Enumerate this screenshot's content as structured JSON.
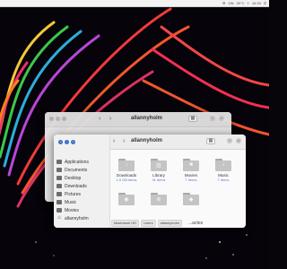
{
  "menubar": {
    "items": [
      "⚙",
      "ON",
      "20°C",
      "≡",
      "10:33",
      "⏻"
    ]
  },
  "back_window": {
    "title": "allannyholm"
  },
  "front_window": {
    "title": "allannyholm",
    "sidebar": {
      "items": [
        {
          "label": "Applications",
          "icon": "applications-icon"
        },
        {
          "label": "Documents",
          "icon": "documents-icon"
        },
        {
          "label": "Desktop",
          "icon": "desktop-icon"
        },
        {
          "label": "Downloads",
          "icon": "downloads-icon"
        },
        {
          "label": "Pictures",
          "icon": "pictures-icon"
        },
        {
          "label": "Music",
          "icon": "music-icon"
        },
        {
          "label": "Movies",
          "icon": "movies-icon"
        },
        {
          "label": "allannyholm",
          "icon": "home-icon"
        }
      ]
    },
    "files": [
      {
        "name": "Downloads",
        "size": "1.5 GB items",
        "glyph": "↓"
      },
      {
        "name": "Library",
        "size": "31 items",
        "glyph": "▥"
      },
      {
        "name": "Movies",
        "size": "7 items",
        "glyph": "■"
      },
      {
        "name": "Music",
        "size": "7 items",
        "glyph": "♪"
      },
      {
        "name": "",
        "size": "",
        "glyph": "◉"
      },
      {
        "name": "",
        "size": "",
        "glyph": "⊕"
      },
      {
        "name": "",
        "size": "",
        "glyph": "◆"
      }
    ],
    "pathbar": [
      "Macintosh HD",
      "Users",
      "allannyholm"
    ],
    "partial_label": "...actes"
  }
}
